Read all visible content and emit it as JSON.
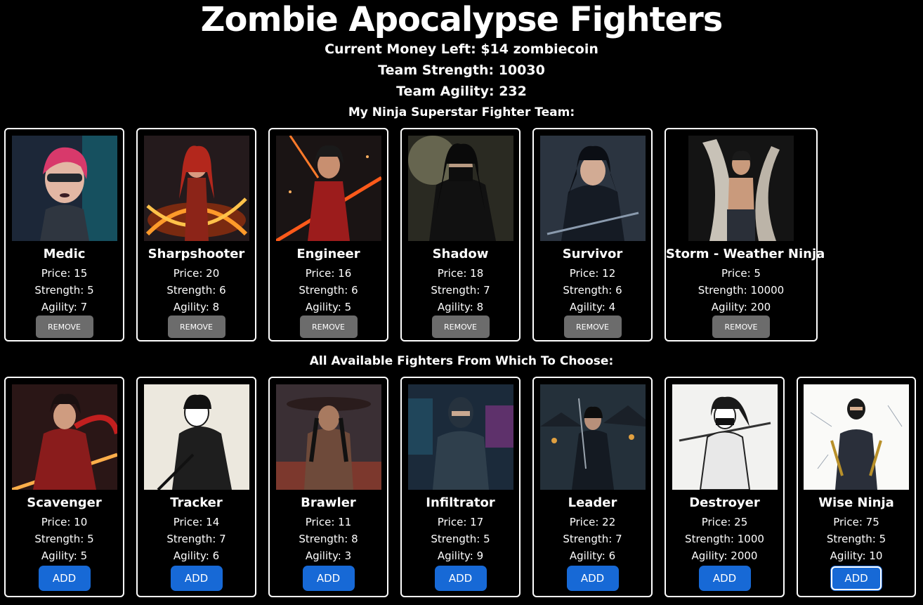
{
  "title": "Zombie Apocalypse Fighters",
  "stats": {
    "money": "Current Money Left: $14 zombiecoin",
    "strength": "Team Strength: 10030",
    "agility": "Team Agility: 232"
  },
  "team_heading": "My Ninja Superstar Fighter Team:",
  "available_heading": "All Available Fighters From Which To Choose:",
  "colors": {
    "background": "#000000",
    "remove_button": "#6c6c6c",
    "add_button": "#1769d6"
  },
  "team": [
    {
      "name": "Medic",
      "price": "Price: 15",
      "strength": "Strength: 5",
      "agility": "Agility: 7",
      "button": "REMOVE"
    },
    {
      "name": "Sharpshooter",
      "price": "Price: 20",
      "strength": "Strength: 6",
      "agility": "Agility: 8",
      "button": "REMOVE"
    },
    {
      "name": "Engineer",
      "price": "Price: 16",
      "strength": "Strength: 6",
      "agility": "Agility: 5",
      "button": "REMOVE"
    },
    {
      "name": "Shadow",
      "price": "Price: 18",
      "strength": "Strength: 7",
      "agility": "Agility: 8",
      "button": "REMOVE"
    },
    {
      "name": "Survivor",
      "price": "Price: 12",
      "strength": "Strength: 6",
      "agility": "Agility: 4",
      "button": "REMOVE"
    },
    {
      "name": "Storm - Weather Ninja",
      "price": "Price: 5",
      "strength": "Strength: 10000",
      "agility": "Agility: 200",
      "button": "REMOVE"
    }
  ],
  "available": [
    {
      "name": "Scavenger",
      "price": "Price: 10",
      "strength": "Strength: 5",
      "agility": "Agility: 5",
      "button": "ADD"
    },
    {
      "name": "Tracker",
      "price": "Price: 14",
      "strength": "Strength: 7",
      "agility": "Agility: 6",
      "button": "ADD"
    },
    {
      "name": "Brawler",
      "price": "Price: 11",
      "strength": "Strength: 8",
      "agility": "Agility: 3",
      "button": "ADD"
    },
    {
      "name": "Infiltrator",
      "price": "Price: 17",
      "strength": "Strength: 5",
      "agility": "Agility: 9",
      "button": "ADD"
    },
    {
      "name": "Leader",
      "price": "Price: 22",
      "strength": "Strength: 7",
      "agility": "Agility: 6",
      "button": "ADD"
    },
    {
      "name": "Destroyer",
      "price": "Price: 25",
      "strength": "Strength: 1000",
      "agility": "Agility: 2000",
      "button": "ADD"
    },
    {
      "name": "Wise Ninja",
      "price": "Price: 75",
      "strength": "Strength: 5",
      "agility": "Agility: 10",
      "button": "ADD"
    }
  ]
}
